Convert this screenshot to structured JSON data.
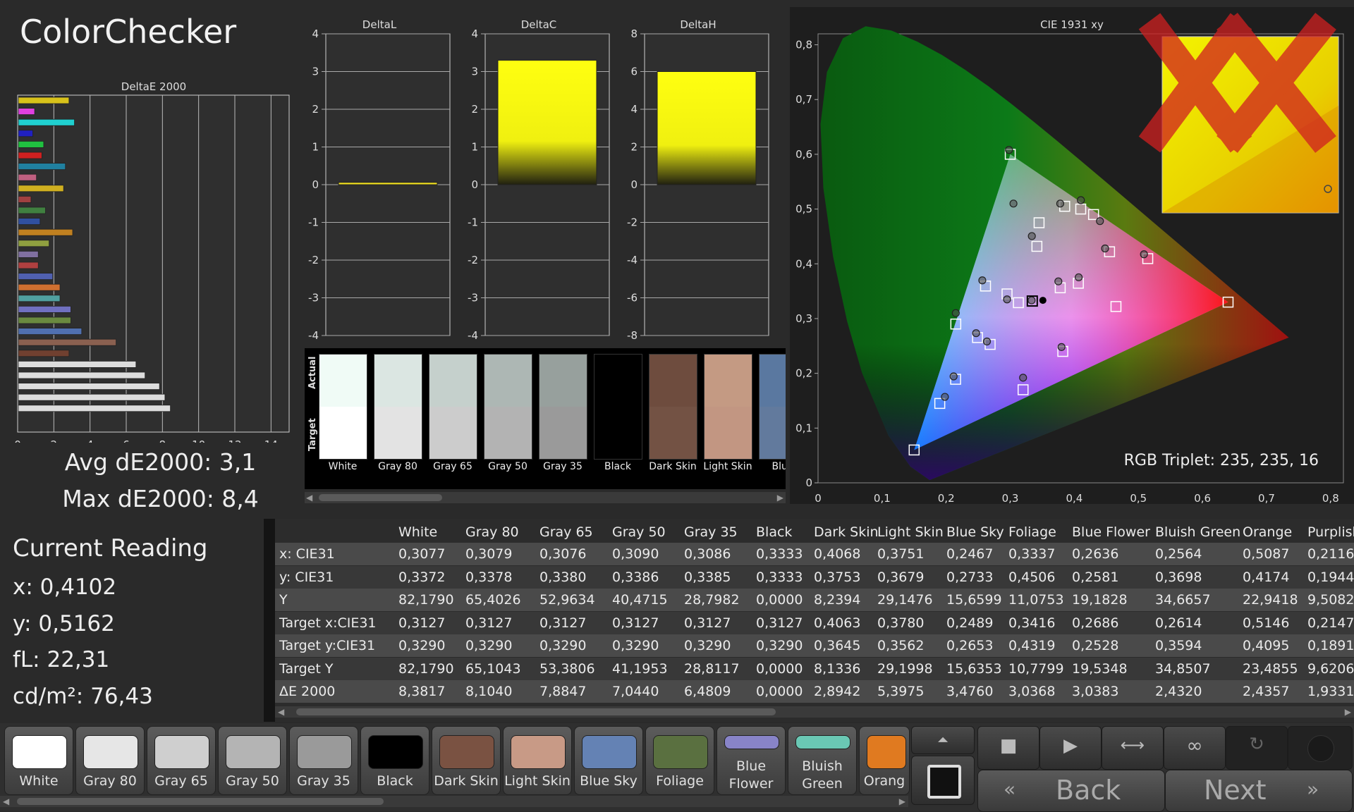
{
  "app": {
    "title": "ColorChecker"
  },
  "charts": {
    "deltae": {
      "title": "DeltaE 2000",
      "ticks": [
        "0",
        "2",
        "4",
        "6",
        "8",
        "10",
        "12",
        "14"
      ],
      "xmax": 15,
      "bars": [
        {
          "value": 2.8,
          "color": "#d8c21a"
        },
        {
          "value": 0.9,
          "color": "#e040e0"
        },
        {
          "value": 3.1,
          "color": "#20d0d0"
        },
        {
          "value": 0.8,
          "color": "#2020c0"
        },
        {
          "value": 1.4,
          "color": "#20c040"
        },
        {
          "value": 1.3,
          "color": "#d02020"
        },
        {
          "value": 2.6,
          "color": "#2080a0"
        },
        {
          "value": 1.0,
          "color": "#c06080"
        },
        {
          "value": 2.5,
          "color": "#d0b020"
        },
        {
          "value": 0.7,
          "color": "#a04040"
        },
        {
          "value": 1.5,
          "color": "#408040"
        },
        {
          "value": 1.2,
          "color": "#3050a0"
        },
        {
          "value": 3.0,
          "color": "#c08020"
        },
        {
          "value": 1.7,
          "color": "#90a040"
        },
        {
          "value": 1.1,
          "color": "#8070a0"
        },
        {
          "value": 1.1,
          "color": "#b04040"
        },
        {
          "value": 1.9,
          "color": "#5060b0"
        },
        {
          "value": 2.3,
          "color": "#d07030"
        },
        {
          "value": 2.3,
          "color": "#50a0a0"
        },
        {
          "value": 2.9,
          "color": "#7070c0"
        },
        {
          "value": 2.9,
          "color": "#6a8a40"
        },
        {
          "value": 3.5,
          "color": "#5070b0"
        },
        {
          "value": 5.4,
          "color": "#8a6050"
        },
        {
          "value": 2.8,
          "color": "#704030"
        },
        {
          "value": 6.5,
          "color": "#dddddd"
        },
        {
          "value": 7.0,
          "color": "#dddddd"
        },
        {
          "value": 7.8,
          "color": "#dddddd"
        },
        {
          "value": 8.1,
          "color": "#dddddd"
        },
        {
          "value": 8.4,
          "color": "#dddddd"
        }
      ]
    },
    "deltal": {
      "title": "DeltaL",
      "ticks": [
        "4",
        "3",
        "2",
        "1",
        "0",
        "-1",
        "-2",
        "-3",
        "-4"
      ],
      "max": 4,
      "value": 0.06
    },
    "deltac": {
      "title": "DeltaC",
      "ticks": [
        "4",
        "3",
        "2",
        "1",
        "0",
        "-1",
        "-2",
        "-3",
        "-4"
      ],
      "max": 4,
      "value": 3.3
    },
    "deltah": {
      "title": "DeltaH",
      "ticks": [
        "8",
        "6",
        "4",
        "2",
        "0",
        "-2",
        "-4",
        "-6",
        "-8"
      ],
      "max": 8,
      "value": 6.0
    },
    "cie": {
      "title": "CIE 1931 xy",
      "xticks": [
        "0",
        "0,1",
        "0,2",
        "0,3",
        "0,4",
        "0,5",
        "0,6",
        "0,7",
        "0,8"
      ],
      "yticks": [
        "0",
        "0,1",
        "0,2",
        "0,3",
        "0,4",
        "0,5",
        "0,6",
        "0,7",
        "0,8"
      ],
      "gamut": [
        [
          0.64,
          0.33
        ],
        [
          0.3,
          0.6
        ],
        [
          0.15,
          0.06
        ]
      ],
      "targets": [
        [
          0.64,
          0.33
        ],
        [
          0.3,
          0.6
        ],
        [
          0.15,
          0.06
        ],
        [
          0.3127,
          0.329
        ],
        [
          0.4063,
          0.3645
        ],
        [
          0.378,
          0.3562
        ],
        [
          0.2489,
          0.2653
        ],
        [
          0.3416,
          0.4319
        ],
        [
          0.2686,
          0.2528
        ],
        [
          0.2614,
          0.3594
        ],
        [
          0.5146,
          0.4095
        ],
        [
          0.2147,
          0.1891
        ],
        [
          0.455,
          0.422
        ],
        [
          0.43,
          0.49
        ],
        [
          0.385,
          0.505
        ],
        [
          0.215,
          0.29
        ],
        [
          0.19,
          0.145
        ],
        [
          0.345,
          0.475
        ],
        [
          0.295,
          0.345
        ],
        [
          0.382,
          0.24
        ],
        [
          0.32,
          0.17
        ],
        [
          0.465,
          0.322
        ],
        [
          0.41,
          0.5
        ]
      ],
      "actuals": [
        [
          0.4068,
          0.3753
        ],
        [
          0.3751,
          0.3679
        ],
        [
          0.2467,
          0.2733
        ],
        [
          0.3337,
          0.4506
        ],
        [
          0.2636,
          0.2581
        ],
        [
          0.2564,
          0.3698
        ],
        [
          0.5087,
          0.4174
        ],
        [
          0.2116,
          0.1944
        ],
        [
          0.298,
          0.608
        ],
        [
          0.4102,
          0.5162
        ],
        [
          0.448,
          0.428
        ],
        [
          0.44,
          0.478
        ],
        [
          0.378,
          0.51
        ],
        [
          0.215,
          0.31
        ],
        [
          0.198,
          0.157
        ],
        [
          0.295,
          0.335
        ],
        [
          0.32,
          0.192
        ],
        [
          0.38,
          0.248
        ],
        [
          0.305,
          0.51
        ],
        [
          0.3333,
          0.3333
        ]
      ],
      "current": [
        0.3333,
        0.3333
      ],
      "zoom_marker": [
        0.8,
        0.5
      ],
      "rgb_label": "RGB Triplet: 235, 235, 16"
    }
  },
  "swatches": {
    "actual_label": "Actual",
    "target_label": "Target",
    "items": [
      {
        "label": "White",
        "actual": "#f0fbf6",
        "target": "#ffffff"
      },
      {
        "label": "Gray 80",
        "actual": "#dbe6e2",
        "target": "#e3e3e3"
      },
      {
        "label": "Gray 65",
        "actual": "#c5d0cc",
        "target": "#cccccc"
      },
      {
        "label": "Gray 50",
        "actual": "#adb7b4",
        "target": "#b3b3b3"
      },
      {
        "label": "Gray 35",
        "actual": "#97a09d",
        "target": "#9a9a9a"
      },
      {
        "label": "Black",
        "actual": "#000000",
        "target": "#000000"
      },
      {
        "label": "Dark Skin",
        "actual": "#6e4c3e",
        "target": "#735244"
      },
      {
        "label": "Light Skin",
        "actual": "#c49a83",
        "target": "#c29682"
      },
      {
        "label": "Blue",
        "actual": "#5a78a0",
        "target": "#627a9d"
      }
    ]
  },
  "stats": {
    "avg": "Avg dE2000: 3,1",
    "max": "Max dE2000: 8,4"
  },
  "reading": {
    "title": "Current Reading",
    "x": "x: 0,4102",
    "y": "y: 0,5162",
    "fl": "fL: 22,31",
    "cdm2": "cd/m²: 76,43"
  },
  "table": {
    "columns": [
      "White",
      "Gray 80",
      "Gray 65",
      "Gray 50",
      "Gray 35",
      "Black",
      "Dark Skin",
      "Light Skin",
      "Blue Sky",
      "Foliage",
      "Blue Flower",
      "Bluish Green",
      "Orange",
      "Purplish"
    ],
    "rows": [
      {
        "label": "x: CIE31",
        "values": [
          "0,3077",
          "0,3079",
          "0,3076",
          "0,3090",
          "0,3086",
          "0,3333",
          "0,4068",
          "0,3751",
          "0,2467",
          "0,3337",
          "0,2636",
          "0,2564",
          "0,5087",
          "0,2116"
        ]
      },
      {
        "label": "y: CIE31",
        "values": [
          "0,3372",
          "0,3378",
          "0,3380",
          "0,3386",
          "0,3385",
          "0,3333",
          "0,3753",
          "0,3679",
          "0,2733",
          "0,4506",
          "0,2581",
          "0,3698",
          "0,4174",
          "0,1944"
        ]
      },
      {
        "label": "Y",
        "values": [
          "82,1790",
          "65,4026",
          "52,9634",
          "40,4715",
          "28,7982",
          "0,0000",
          "8,2394",
          "29,1476",
          "15,6599",
          "11,0753",
          "19,1828",
          "34,6657",
          "22,9418",
          "9,5082"
        ]
      },
      {
        "label": "Target x:CIE31",
        "values": [
          "0,3127",
          "0,3127",
          "0,3127",
          "0,3127",
          "0,3127",
          "0,3127",
          "0,4063",
          "0,3780",
          "0,2489",
          "0,3416",
          "0,2686",
          "0,2614",
          "0,5146",
          "0,2147"
        ]
      },
      {
        "label": "Target y:CIE31",
        "values": [
          "0,3290",
          "0,3290",
          "0,3290",
          "0,3290",
          "0,3290",
          "0,3290",
          "0,3645",
          "0,3562",
          "0,2653",
          "0,4319",
          "0,2528",
          "0,3594",
          "0,4095",
          "0,1891"
        ]
      },
      {
        "label": "Target Y",
        "values": [
          "82,1790",
          "65,1043",
          "53,3806",
          "41,1953",
          "28,8117",
          "0,0000",
          "8,1336",
          "29,1998",
          "15,6353",
          "10,7799",
          "19,5348",
          "34,8507",
          "23,4855",
          "9,6206"
        ]
      },
      {
        "label": "ΔE 2000",
        "values": [
          "8,3817",
          "8,1040",
          "7,8847",
          "7,0440",
          "6,4809",
          "0,0000",
          "2,8942",
          "5,3975",
          "3,4760",
          "3,0368",
          "3,0383",
          "2,4320",
          "2,4357",
          "1,9331"
        ]
      }
    ]
  },
  "patches": [
    {
      "label": "White",
      "color": "#ffffff"
    },
    {
      "label": "Gray 80",
      "color": "#e6e6e6"
    },
    {
      "label": "Gray 65",
      "color": "#cfcfcf"
    },
    {
      "label": "Gray 50",
      "color": "#b4b4b4"
    },
    {
      "label": "Gray 35",
      "color": "#9a9a9a"
    },
    {
      "label": "Black",
      "color": "#000000"
    },
    {
      "label": "Dark Skin",
      "color": "#7a5242"
    },
    {
      "label": "Light Skin",
      "color": "#c89a86"
    },
    {
      "label": "Blue Sky",
      "color": "#6482b4"
    },
    {
      "label": "Foliage",
      "color": "#5a7040"
    },
    {
      "label": "Blue Flower",
      "color": "#8884c8"
    },
    {
      "label": "Bluish Green",
      "color": "#6ac8b4"
    },
    {
      "label": "Orang",
      "color": "#e07a20"
    }
  ],
  "nav": {
    "back": "Back",
    "next": "Next"
  },
  "icons": {
    "up": "chevron-up-icon",
    "stop": "stop-icon",
    "play": "play-icon",
    "fit": "fit-width-icon",
    "loop": "infinity-icon",
    "refresh": "refresh-icon"
  }
}
